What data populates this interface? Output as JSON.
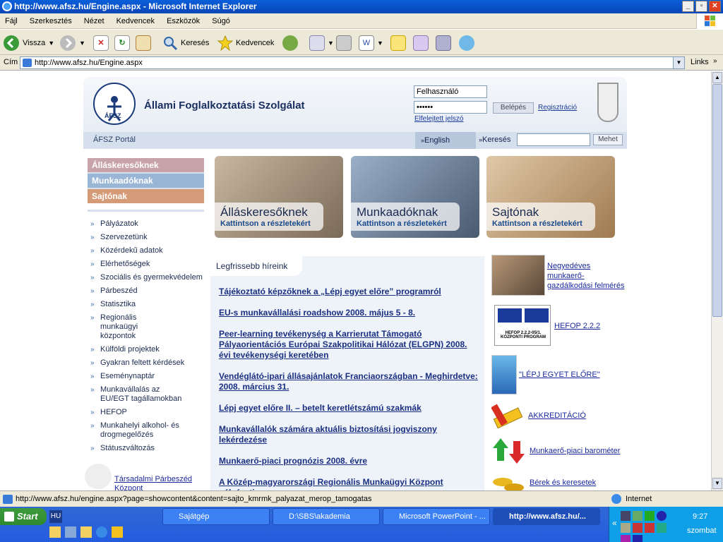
{
  "window": {
    "title": "http://www.afsz.hu/Engine.aspx - Microsoft Internet Explorer"
  },
  "menu": [
    "Fájl",
    "Szerkesztés",
    "Nézet",
    "Kedvencek",
    "Eszközök",
    "Súgó"
  ],
  "toolbar": {
    "back": "Vissza",
    "search": "Keresés",
    "favorites": "Kedvencek"
  },
  "address": {
    "label": "Cím",
    "url": "http://www.afsz.hu/Engine.aspx",
    "links": "Links"
  },
  "page": {
    "org_name": "Állami Foglalkoztatási Szolgálat",
    "logo_text": "ÁFSZ",
    "login": {
      "user_placeholder": "Felhasználó",
      "password": "••••••",
      "login_button": "Belépés",
      "register": "Regisztráció",
      "forgot": "Elfelejtett jelszó"
    },
    "nav": {
      "portal": "ÁFSZ Portál",
      "english": "English",
      "search_label": "Keresés",
      "search_button": "Mehet"
    },
    "categories": [
      {
        "label": "Álláskeresőknek",
        "color": "#c9a3aa"
      },
      {
        "label": "Munkaadóknak",
        "color": "#9ab6d6"
      },
      {
        "label": "Sajtónak",
        "color": "#d59a77"
      }
    ],
    "left_menu": [
      "Pályázatok",
      "Szervezetünk",
      "Közérdekű adatok",
      "Elérhetőségek",
      "Szociális és gyermekvédelem",
      "Párbeszéd",
      "Statisztika",
      "Regionális munkaügyi központok",
      "Külföldi projektek",
      "Gyakran feltett kérdések",
      "Eseménynaptár",
      "Munkavállalás az EU/EGT tagállamokban",
      "HEFOP",
      "Munkahelyi alkohol- és drogmegelőzés",
      "Státuszváltozás"
    ],
    "left_bottom": "Társadalmi Párbeszéd Központ",
    "banners": [
      {
        "title": "Álláskeresőknek",
        "sub": "Kattintson a részletekért"
      },
      {
        "title": "Munkaadóknak",
        "sub": "Kattintson a részletekért"
      },
      {
        "title": "Sajtónak",
        "sub": "Kattintson a részletekért"
      }
    ],
    "news_heading": "Legfrissebb híreink",
    "news": [
      "Tájékoztató képzőknek a „Lépj egyet előre” programról",
      "EU-s munkavállalási roadshow 2008. május 5 - 8.",
      "Peer-learning tevékenység a Karrierutat Támogató Pályaorientációs Európai Szakpolitikai Hálózat (ELGPN) 2008. évi tevékenységi keretében",
      "Vendéglátó-ipari állásajánlatok Franciaországban - Meghirdetve: 2008. március 31.",
      "Lépj egyet előre II. – betelt keretlétszámú szakmák",
      "Munkavállalók számára aktuális biztosítási jogviszony lekérdezése",
      "Munkaerő-piaci prognózis 2008. évre",
      "A Közép-magyarországi Regionális Munkaügyi Központ pályázati"
    ],
    "right": [
      "Negyedéves munkaerő-gazdálkodási felmérés",
      "HEFOP 2.2.2",
      "\"LÉPJ EGYET ELŐRE\"",
      "AKKREDITÁCIÓ",
      "Munkaerő-piaci barométer",
      "Bérek és keresetek"
    ],
    "hefop_box": "HEFOP 2.2.2-05/1. KÖZPONTI PROGRAM"
  },
  "status": {
    "url": "http://www.afsz.hu/engine.aspx?page=showcontent&content=sajto_kmrmk_palyazat_merop_tamogatas",
    "zone": "Internet"
  },
  "taskbar": {
    "start": "Start",
    "lang": "HU",
    "tasks": [
      "Sajátgép",
      "D:\\SBS\\akademia",
      "Microsoft PowerPoint - ...",
      "http://www.afsz.hu/..."
    ],
    "time": "9:27",
    "day": "szombat"
  }
}
